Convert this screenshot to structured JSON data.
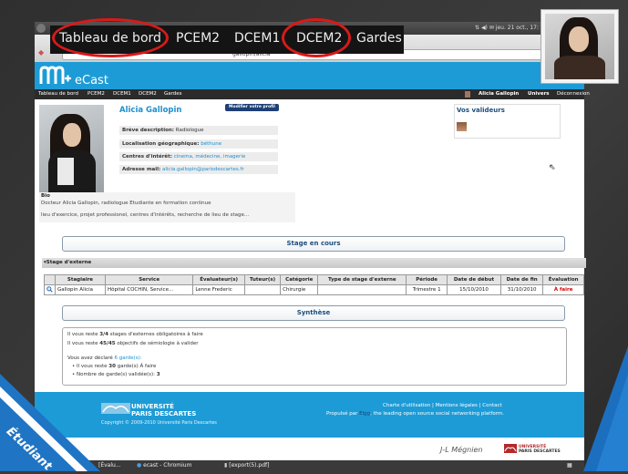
{
  "zoom_menu": {
    "items": [
      "Tableau de bord",
      "PCEM2",
      "DCEM1",
      "DCEM2",
      "Gardes"
    ]
  },
  "system_tray": {
    "datetime": "jeu. 21 oct., 17:"
  },
  "browser": {
    "address_fragment": "gallopin/alicia"
  },
  "site": {
    "logo_text": "eCast"
  },
  "nav": {
    "items": [
      "Tableau de bord",
      "PCEM2",
      "DCEM1",
      "DCEM2",
      "Gardes"
    ],
    "user_name": "Alicia Gallopin",
    "univers": "Univers",
    "logout": "Déconnexion"
  },
  "profile": {
    "name": "Alicia Gallopin",
    "modify_button": "Modifier votre profil",
    "fields": [
      {
        "label": "Brève description:",
        "value": "Radiologue"
      },
      {
        "label": "Localisation géographique:",
        "value": "béthune"
      },
      {
        "label": "Centres d'intérêt:",
        "value": "cinema, médecine, imagerie"
      },
      {
        "label": "Adresse mail:",
        "value": "alicia.gallopin@parisdescartes.fr"
      }
    ],
    "bio_title": "Bio",
    "bio_line1": "Docteur Alicia Gallopin, radiologue Etudiante en formation continue",
    "bio_line2": "lieu d'exercice, projet professionel, centres d'intérêts, recherche de lieu de stage..."
  },
  "validators": {
    "title": "Vos valideurs"
  },
  "stage_section": {
    "title": "Stage en cours",
    "collapse_label": "▾Stage d'externe",
    "columns": [
      "Stagiaire",
      "Service",
      "Évaluateur(s)",
      "Tuteur(s)",
      "Catégorie",
      "Type de stage d'externe",
      "Période",
      "Date de début",
      "Date de fin",
      "Évaluation"
    ],
    "rows": [
      [
        "Gallopin Alicia",
        "Hôpital COCHIN, Service...",
        "Lenne Frederic",
        "",
        "Chirurgie",
        "",
        "Trimestre 1",
        "15/10/2010",
        "31/10/2010",
        "À faire"
      ]
    ]
  },
  "synthese": {
    "title": "Synthèse",
    "line1_a": "Il vous reste ",
    "line1_b": "3/4",
    "line1_c": " stages d'externes obligatoires à faire",
    "line2_a": "Il vous reste ",
    "line2_b": "45/45",
    "line2_c": " objectifs de sémiologie à valider",
    "line3_a": "Vous avez déclaré ",
    "line3_b": "6 garde(s):",
    "bullet1_a": "Il vous reste ",
    "bullet1_b": "30",
    "bullet1_c": " garde(s) À faire",
    "bullet2_a": "Nombre de garde(s) validée(s): ",
    "bullet2_b": "3"
  },
  "footer": {
    "university_line1": "UNIVERSITÉ",
    "university_line2": "PARIS DESCARTES",
    "copyright": "Copyright © 2009-2010 Université Paris Descartes",
    "links": [
      "Charte d'utilisation",
      "Mentions légales",
      "Contact"
    ],
    "powered_a": "Propulsé par ",
    "powered_b": "Elgg",
    "powered_c": ", the leading open source social networking platform.",
    "author": "J-L Mégnien",
    "logo2_line1": "UNIVERSITÉ",
    "logo2_line2": "PARIS DESCARTES"
  },
  "taskbar": {
    "items": [
      "[Évalu...",
      "ecast - Chromium",
      "[export(5).pdf]"
    ]
  },
  "corner_badge": {
    "label": "Étudiant"
  },
  "colors": {
    "brand_blue": "#1d9bd6",
    "ring_red": "#d91a1a",
    "todo_red": "#d90000"
  }
}
